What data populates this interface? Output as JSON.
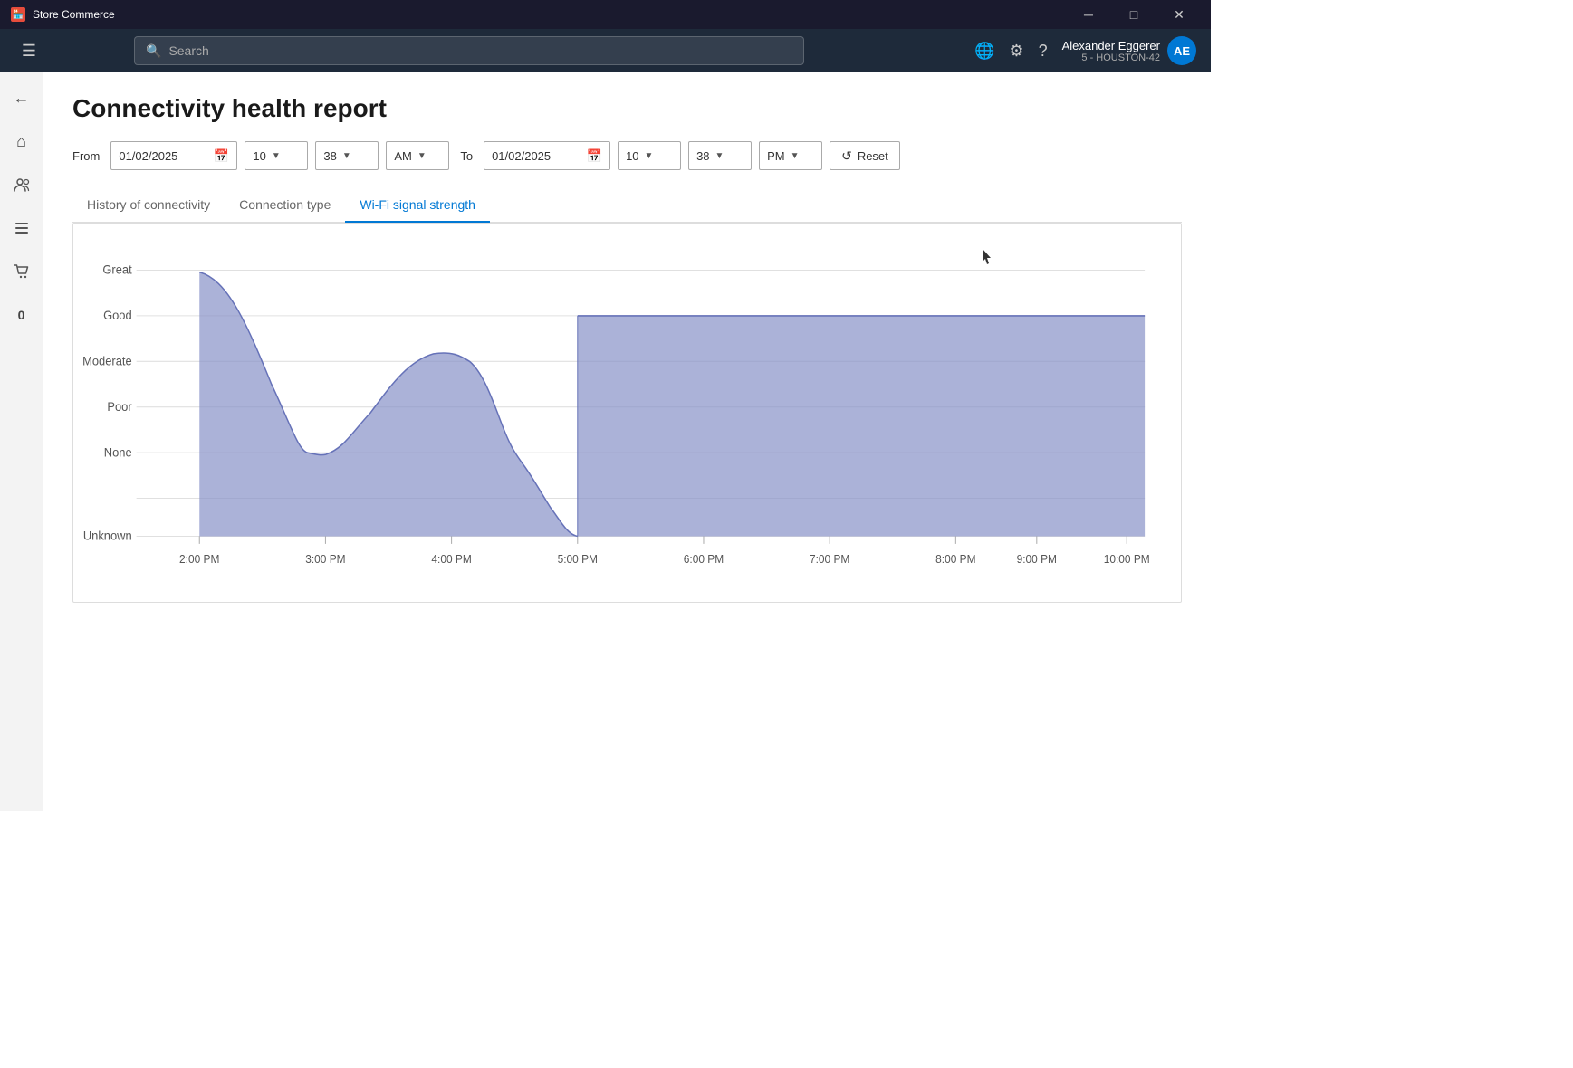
{
  "app": {
    "title": "Store Commerce",
    "titlebar_controls": [
      "minimize",
      "maximize",
      "close"
    ]
  },
  "navbar": {
    "search_placeholder": "Search",
    "user_name": "Alexander Eggerer",
    "user_sub": "5 - HOUSTON-42",
    "user_initials": "AE"
  },
  "sidebar": {
    "items": [
      {
        "name": "back",
        "icon": "←"
      },
      {
        "name": "home",
        "icon": "⌂"
      },
      {
        "name": "users",
        "icon": "👥"
      },
      {
        "name": "menu",
        "icon": "≡"
      },
      {
        "name": "cart",
        "icon": "🛒"
      },
      {
        "name": "zero",
        "icon": "0"
      }
    ]
  },
  "page": {
    "title": "Connectivity health report",
    "from_label": "From",
    "to_label": "To",
    "from_date": "01/02/2025",
    "from_hour": "10",
    "from_minute": "38",
    "from_ampm": "AM",
    "to_date": "01/02/2025",
    "to_hour": "10",
    "to_minute": "38",
    "to_ampm": "PM",
    "reset_label": "Reset"
  },
  "tabs": [
    {
      "id": "history",
      "label": "History of connectivity",
      "active": false
    },
    {
      "id": "connection",
      "label": "Connection type",
      "active": false
    },
    {
      "id": "wifi",
      "label": "Wi-Fi signal strength",
      "active": true
    }
  ],
  "chart": {
    "y_labels": [
      "Great",
      "Good",
      "Moderate",
      "Poor",
      "None",
      "Unknown"
    ],
    "x_labels": [
      "2:00 PM",
      "3:00 PM",
      "4:00 PM",
      "5:00 PM",
      "6:00 PM",
      "7:00 PM",
      "8:00 PM",
      "9:00 PM",
      "10:00 PM"
    ],
    "color": "#8892c8"
  }
}
